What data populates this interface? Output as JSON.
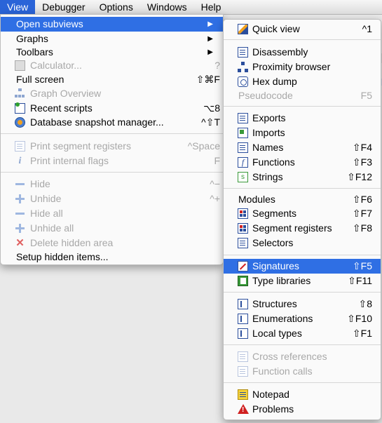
{
  "menubar": {
    "items": [
      {
        "label": "View",
        "active": true
      },
      {
        "label": "Debugger",
        "active": false
      },
      {
        "label": "Options",
        "active": false
      },
      {
        "label": "Windows",
        "active": false
      },
      {
        "label": "Help",
        "active": false
      }
    ]
  },
  "view_menu": {
    "items": [
      {
        "label": "Open subviews",
        "shortcut": "",
        "has_submenu": true,
        "icon": "",
        "enabled": true,
        "highlighted": true
      },
      {
        "label": "Graphs",
        "shortcut": "",
        "has_submenu": true,
        "icon": "",
        "enabled": true
      },
      {
        "label": "Toolbars",
        "shortcut": "",
        "has_submenu": true,
        "icon": "",
        "enabled": true
      },
      {
        "label": "Calculator...",
        "shortcut": "?",
        "icon": "calculator-icon",
        "enabled": false
      },
      {
        "label": "Full screen",
        "shortcut": "⇧⌘F",
        "icon": "",
        "enabled": true
      },
      {
        "label": "Graph Overview",
        "shortcut": "",
        "icon": "graph-overview-icon",
        "enabled": false
      },
      {
        "label": "Recent scripts",
        "shortcut": "⌥8",
        "icon": "recent-scripts-icon",
        "enabled": true
      },
      {
        "label": "Database snapshot manager...",
        "shortcut": "^⇧T",
        "icon": "database-snapshot-icon",
        "enabled": true
      },
      {
        "label": "Print segment registers",
        "shortcut": "^Space",
        "icon": "print-segment-registers-icon",
        "enabled": false
      },
      {
        "label": "Print internal flags",
        "shortcut": "F",
        "icon": "info-icon",
        "enabled": false
      },
      {
        "label": "Hide",
        "shortcut": "^−",
        "icon": "hide-icon",
        "enabled": false
      },
      {
        "label": "Unhide",
        "shortcut": "^+",
        "icon": "unhide-icon",
        "enabled": false
      },
      {
        "label": "Hide all",
        "shortcut": "",
        "icon": "hide-all-icon",
        "enabled": false
      },
      {
        "label": "Unhide all",
        "shortcut": "",
        "icon": "unhide-all-icon",
        "enabled": false
      },
      {
        "label": "Delete hidden area",
        "shortcut": "",
        "icon": "delete-icon",
        "enabled": false
      },
      {
        "label": "Setup hidden items...",
        "shortcut": "",
        "icon": "",
        "enabled": true
      }
    ]
  },
  "subviews_menu": {
    "items": [
      {
        "label": "Quick view",
        "shortcut": "^1",
        "icon": "quick-view-icon",
        "enabled": true
      },
      {
        "label": "Disassembly",
        "shortcut": "",
        "icon": "disassembly-icon",
        "enabled": true
      },
      {
        "label": "Proximity browser",
        "shortcut": "",
        "icon": "proximity-browser-icon",
        "enabled": true
      },
      {
        "label": "Hex dump",
        "shortcut": "",
        "icon": "hex-dump-icon",
        "enabled": true
      },
      {
        "label": "Pseudocode",
        "shortcut": "F5",
        "icon": "",
        "enabled": false
      },
      {
        "label": "Exports",
        "shortcut": "",
        "icon": "exports-icon",
        "enabled": true
      },
      {
        "label": "Imports",
        "shortcut": "",
        "icon": "imports-icon",
        "enabled": true
      },
      {
        "label": "Names",
        "shortcut": "⇧F4",
        "icon": "names-icon",
        "enabled": true
      },
      {
        "label": "Functions",
        "shortcut": "⇧F3",
        "icon": "functions-icon",
        "enabled": true
      },
      {
        "label": "Strings",
        "shortcut": "⇧F12",
        "icon": "strings-icon",
        "enabled": true
      },
      {
        "label": "Modules",
        "shortcut": "⇧F6",
        "icon": "",
        "enabled": true
      },
      {
        "label": "Segments",
        "shortcut": "⇧F7",
        "icon": "segments-icon",
        "enabled": true
      },
      {
        "label": "Segment registers",
        "shortcut": "⇧F8",
        "icon": "segment-registers-icon",
        "enabled": true
      },
      {
        "label": "Selectors",
        "shortcut": "",
        "icon": "selectors-icon",
        "enabled": true
      },
      {
        "label": "Signatures",
        "shortcut": "⇧F5",
        "icon": "signatures-icon",
        "enabled": true,
        "highlighted": true
      },
      {
        "label": "Type libraries",
        "shortcut": "⇧F11",
        "icon": "type-libraries-icon",
        "enabled": true
      },
      {
        "label": "Structures",
        "shortcut": "⇧8",
        "icon": "structures-icon",
        "enabled": true
      },
      {
        "label": "Enumerations",
        "shortcut": "⇧F10",
        "icon": "enumerations-icon",
        "enabled": true
      },
      {
        "label": "Local types",
        "shortcut": "⇧F1",
        "icon": "local-types-icon",
        "enabled": true
      },
      {
        "label": "Cross references",
        "shortcut": "",
        "icon": "cross-references-icon",
        "enabled": false
      },
      {
        "label": "Function calls",
        "shortcut": "",
        "icon": "function-calls-icon",
        "enabled": false
      },
      {
        "label": "Notepad",
        "shortcut": "",
        "icon": "notepad-icon",
        "enabled": true
      },
      {
        "label": "Problems",
        "shortcut": "",
        "icon": "problems-icon",
        "enabled": true
      }
    ]
  },
  "colors": {
    "menubar_highlight": "#2a64d8",
    "item_highlight": "#2f6fe4",
    "disabled_text": "#a8a8a8"
  }
}
